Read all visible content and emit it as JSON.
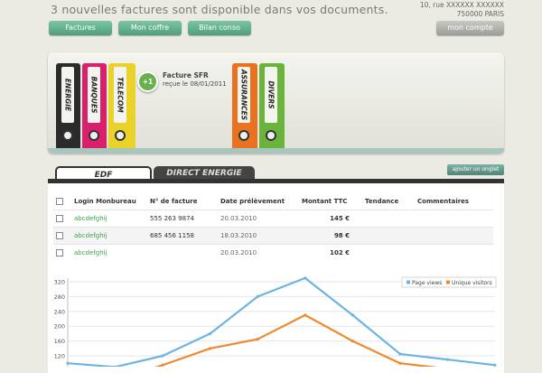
{
  "header": {
    "message": "3 nouvelles factures sont disponible dans vos documents.",
    "address_line1": "10, rue XXXXXX XXXXXX",
    "address_line2": "750000 PARIS"
  },
  "nav": {
    "factures": "Factures",
    "coffre": "Mon coffre",
    "bilan": "Bilan conso",
    "compte": "mon compte"
  },
  "banner": {
    "binders": [
      {
        "label": "ENERGIE",
        "color": "#2b2b2b"
      },
      {
        "label": "BANQUES",
        "color": "#d8206b"
      },
      {
        "label": "TELECOM",
        "color": "#e9d22a"
      },
      {
        "label": "ASSURANCES",
        "color": "#e8721f"
      },
      {
        "label": "DIVERS",
        "color": "#6ab43c"
      }
    ],
    "badge": "+1",
    "invoice_title": "Facture SFR",
    "invoice_date": "reçue le 08/01/2011"
  },
  "tabs": {
    "edf": "EDF",
    "direct": "DIRECT ENERGIE",
    "add": "ajouter un onglet"
  },
  "table": {
    "headers": [
      "Login Monbureau",
      "N° de facture",
      "Date prélèvement",
      "Montant TTC",
      "Tendance",
      "Commentaires"
    ],
    "rows": [
      {
        "login": "abcdefghij",
        "invoice": "555 263 9874",
        "date": "20.03.2010",
        "amount": "145 €"
      },
      {
        "login": "abcdefghij",
        "invoice": "685 456 1158",
        "date": "18.03.2010",
        "amount": "98 €"
      },
      {
        "login": "abcdefghij",
        "invoice": "",
        "date": "20.03.2010",
        "amount": "102 €"
      }
    ]
  },
  "chart_data": {
    "type": "line",
    "y_ticks": [
      "320",
      "280",
      "240",
      "200",
      "160",
      "120"
    ],
    "ylim": [
      100,
      320
    ],
    "x": [
      0,
      1,
      2,
      3,
      4,
      5,
      6,
      7,
      8,
      9
    ],
    "series": [
      {
        "name": "Page views",
        "color": "#6cb4e4",
        "values": [
          100,
          90,
          120,
          180,
          280,
          330,
          230,
          125,
          110,
          95
        ]
      },
      {
        "name": "Unique visitors",
        "color": "#f0892e",
        "values": [
          65,
          55,
          95,
          140,
          165,
          230,
          160,
          100,
          85,
          70
        ]
      }
    ],
    "legend": "top-right"
  }
}
